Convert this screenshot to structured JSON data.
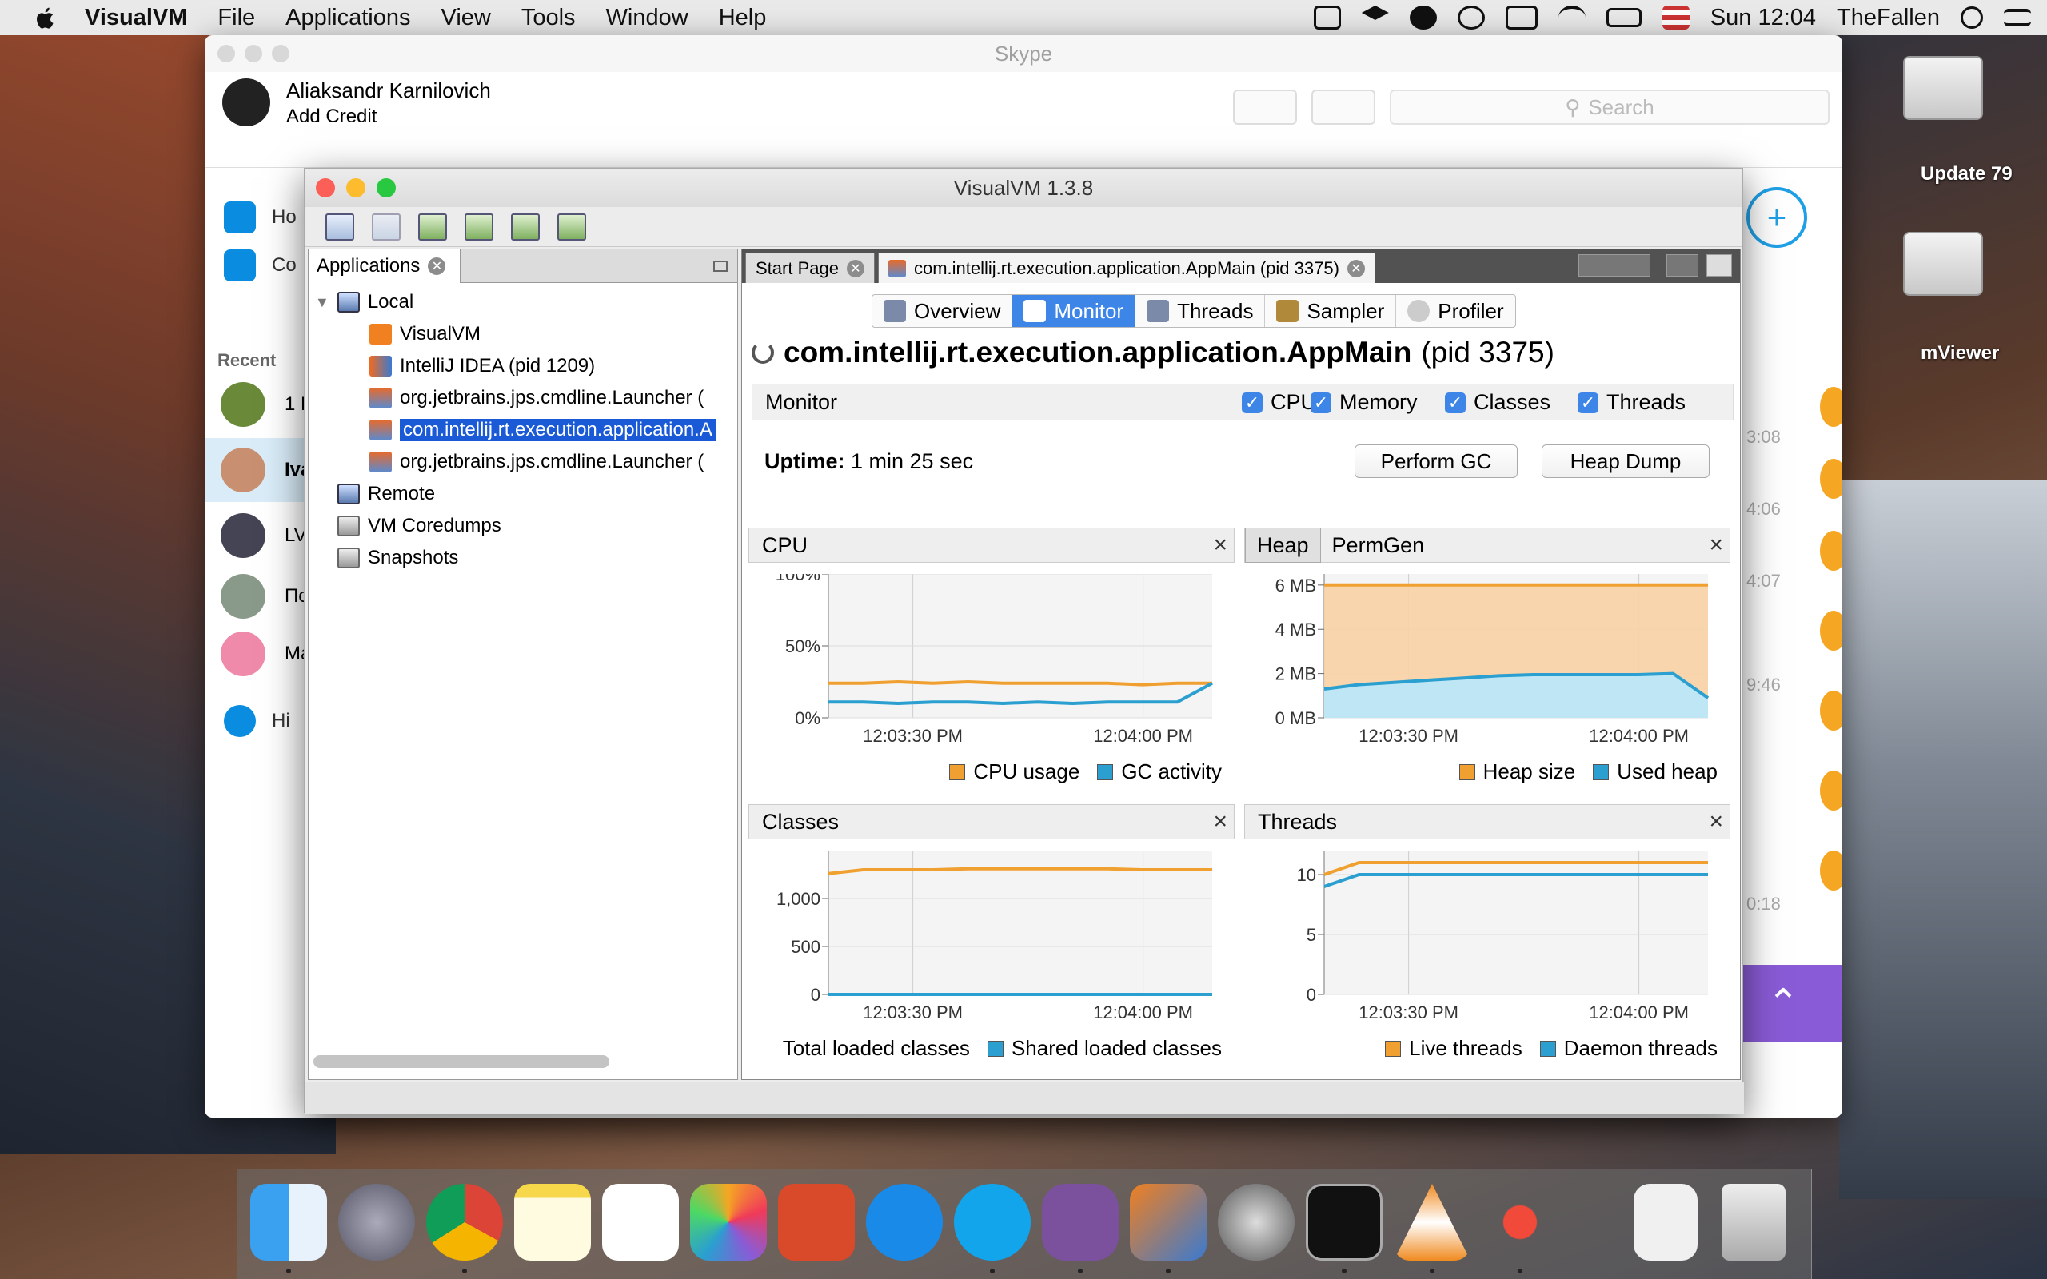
{
  "menubar": {
    "app_name": "VisualVM",
    "items": [
      "File",
      "Applications",
      "View",
      "Tools",
      "Window",
      "Help"
    ],
    "clock": "Sun 12:04",
    "user": "TheFallen"
  },
  "desktop": {
    "drive1_label": "Update 79",
    "drive2_label": "mViewer"
  },
  "skype": {
    "window_title": "Skype",
    "user_name": "Aliaksandr Karnilovich",
    "credit": "Add Credit",
    "search_placeholder": "Search",
    "nav": [
      "Ho",
      "Co"
    ],
    "recent_label": "Recent",
    "recent_rows": [
      "1 L",
      "Iva",
      "LV",
      "По",
      "Ma"
    ],
    "history": "Hi",
    "times": [
      "3:08",
      "4:06",
      "4:07",
      "9:46",
      "0:18"
    ]
  },
  "visualvm": {
    "window_title": "VisualVM 1.3.8",
    "left_tab": "Applications",
    "tree": {
      "local": "Local",
      "items": [
        "VisualVM",
        "IntelliJ IDEA (pid 1209)",
        "org.jetbrains.jps.cmdline.Launcher (",
        "com.intellij.rt.execution.application.A",
        "org.jetbrains.jps.cmdline.Launcher ("
      ],
      "remote": "Remote",
      "coredumps": "VM Coredumps",
      "snapshots": "Snapshots"
    },
    "doc_tabs": [
      "Start Page",
      "com.intellij.rt.execution.application.AppMain (pid 3375)"
    ],
    "sub_tabs": [
      "Overview",
      "Monitor",
      "Threads",
      "Sampler",
      "Profiler"
    ],
    "app_title": "com.intellij.rt.execution.application.AppMain",
    "app_pid": "(pid 3375)",
    "monitor_label": "Monitor",
    "checkboxes": [
      "CPU",
      "Memory",
      "Classes",
      "Threads"
    ],
    "uptime_label": "Uptime:",
    "uptime_value": "1 min 25 sec",
    "perform_gc": "Perform GC",
    "heap_dump": "Heap Dump",
    "panels": {
      "cpu_title": "CPU",
      "heap_tab": "Heap",
      "permgen_tab": "PermGen",
      "classes_title": "Classes",
      "threads_title": "Threads"
    }
  },
  "colors": {
    "orange": "#f0a030",
    "blue": "#2a9fd0",
    "accent": "#3d86e8"
  },
  "chart_data": [
    {
      "type": "line",
      "title": "CPU",
      "x": [
        "12:03:30 PM",
        "12:04:00 PM"
      ],
      "yticks": [
        "100%",
        "50%",
        "0%"
      ],
      "ylim": [
        0,
        100
      ],
      "series": [
        {
          "name": "CPU usage",
          "values": [
            24,
            24,
            25,
            24,
            25,
            24,
            24,
            24,
            24,
            23,
            24,
            24
          ]
        },
        {
          "name": "GC activity",
          "values": [
            11,
            11,
            10,
            11,
            11,
            10,
            11,
            10,
            11,
            11,
            11,
            24
          ]
        }
      ],
      "legend": [
        "CPU usage",
        "GC activity"
      ]
    },
    {
      "type": "area",
      "title": "Heap",
      "x": [
        "12:03:30 PM",
        "12:04:00 PM"
      ],
      "yticks": [
        "6 MB",
        "4 MB",
        "2 MB",
        "0 MB"
      ],
      "ylim": [
        0,
        6.5
      ],
      "series": [
        {
          "name": "Heap size",
          "values": [
            6,
            6,
            6,
            6,
            6,
            6,
            6,
            6,
            6,
            6,
            6,
            6
          ]
        },
        {
          "name": "Used heap",
          "values": [
            1.3,
            1.5,
            1.6,
            1.7,
            1.8,
            1.9,
            1.95,
            1.95,
            1.95,
            1.95,
            2.0,
            0.9
          ]
        }
      ],
      "legend": [
        "Heap size",
        "Used heap"
      ]
    },
    {
      "type": "line",
      "title": "Classes",
      "x": [
        "12:03:30 PM",
        "12:04:00 PM"
      ],
      "yticks": [
        "1,000",
        "500",
        "0"
      ],
      "ylim": [
        0,
        1500
      ],
      "series": [
        {
          "name": "Total loaded classes",
          "values": [
            1260,
            1300,
            1300,
            1300,
            1310,
            1310,
            1310,
            1310,
            1310,
            1300,
            1300,
            1300
          ]
        },
        {
          "name": "Shared loaded classes",
          "values": [
            0,
            0,
            0,
            0,
            0,
            0,
            0,
            0,
            0,
            0,
            0,
            0
          ]
        }
      ],
      "legend": [
        "Total loaded classes",
        "Shared loaded classes"
      ]
    },
    {
      "type": "line",
      "title": "Threads",
      "x": [
        "12:03:30 PM",
        "12:04:00 PM"
      ],
      "yticks": [
        "10",
        "5",
        "0"
      ],
      "ylim": [
        0,
        12
      ],
      "series": [
        {
          "name": "Live threads",
          "values": [
            10,
            11,
            11,
            11,
            11,
            11,
            11,
            11,
            11,
            11,
            11,
            11
          ]
        },
        {
          "name": "Daemon threads",
          "values": [
            9,
            10,
            10,
            10,
            10,
            10,
            10,
            10,
            10,
            10,
            10,
            10
          ]
        }
      ],
      "legend": [
        "Live threads",
        "Daemon threads"
      ]
    }
  ]
}
